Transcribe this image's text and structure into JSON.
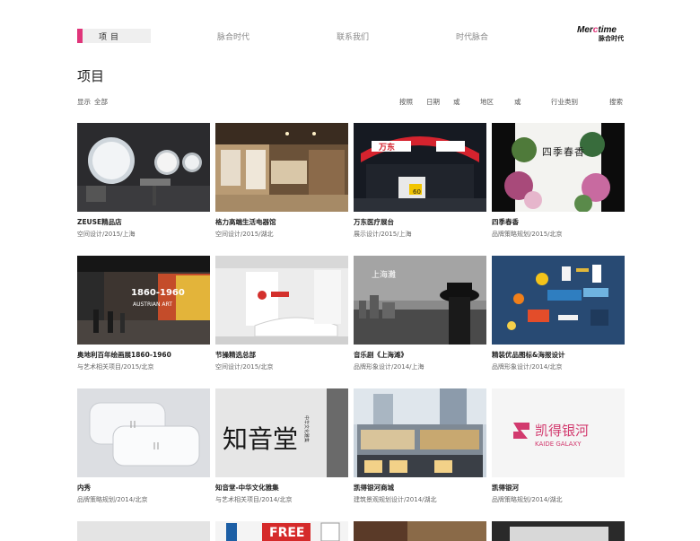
{
  "nav": {
    "active": "项目",
    "items": [
      "脉合时代",
      "联系我们",
      "时代脉合"
    ]
  },
  "logo": {
    "line1_a": "Mer",
    "line1_b": "c",
    "line1_c": "time",
    "line2": "脉合时代"
  },
  "page": {
    "title": "项目"
  },
  "filters": {
    "show_label": "显示",
    "show_value": "全部",
    "by": "按照",
    "date": "日期",
    "or1": "或",
    "region": "地区",
    "or2": "或",
    "industry": "行业类别",
    "search": "搜索"
  },
  "projects": [
    {
      "name": "ZEUSE精品店",
      "meta": "空间设计/2015/上海"
    },
    {
      "name": "格力高端生活电器馆",
      "meta": "空间设计/2015/湖北"
    },
    {
      "name": "万东医疗展台",
      "meta": "展示设计/2015/上海"
    },
    {
      "name": "四季春香",
      "meta": "品牌策略规划/2015/北京"
    },
    {
      "name": "奥地利百年绘画展1860-1960",
      "meta": "与艺术相关项目/2015/北京"
    },
    {
      "name": "节操精选总部",
      "meta": "空间设计/2015/北京"
    },
    {
      "name": "音乐剧《上海滩》",
      "meta": "品牌形象设计/2014/上海"
    },
    {
      "name": "精装优品图标&海报设计",
      "meta": "品牌形象设计/2014/北京"
    },
    {
      "name": "内秀",
      "meta": "品牌策略规划/2014/北京"
    },
    {
      "name": "知音堂-中华文化雅集",
      "meta": "与艺术相关项目/2014/北京"
    },
    {
      "name": "凯得银河商城",
      "meta": "建筑景观规划设计/2014/湖北"
    },
    {
      "name": "凯得银河",
      "meta": "品牌策略规划/2014/湖北"
    }
  ],
  "thumb_text": {
    "wandong_brand": "万东",
    "wandong_60": "60",
    "sijichunxiang": "四季春香",
    "austria_years": "1860-1960",
    "austria_art": "AUSTRIAN ART",
    "shanghaitan": "上海灘",
    "zhiyintang": "知音堂",
    "zhiyintang_side": "中华文化雅集",
    "kaide_cn": "凯得银河",
    "kaide_en": "KAIDE GALAXY",
    "free": "FREE"
  }
}
